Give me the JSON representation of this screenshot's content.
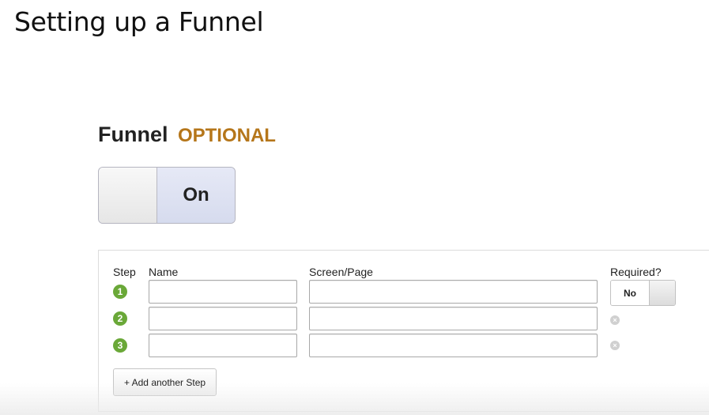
{
  "slide": {
    "title": "Setting up a Funnel"
  },
  "funnel_section": {
    "heading": "Funnel",
    "optional_label": "OPTIONAL",
    "toggle_state": "On"
  },
  "funnel_table": {
    "columns": {
      "step": "Step",
      "name": "Name",
      "screen_page": "Screen/Page",
      "required": "Required?"
    },
    "steps": [
      {
        "number": "1",
        "name_value": "",
        "screen_value": ""
      },
      {
        "number": "2",
        "name_value": "",
        "screen_value": ""
      },
      {
        "number": "3",
        "name_value": "",
        "screen_value": ""
      }
    ],
    "required_toggle_label": "No",
    "add_step_label": "+ Add another Step",
    "remove_icon_glyph": "×"
  },
  "colors": {
    "optional_accent": "#b5761a",
    "step_badge": "#6aa838",
    "toggle_on_bg": "#dfe3f2"
  }
}
